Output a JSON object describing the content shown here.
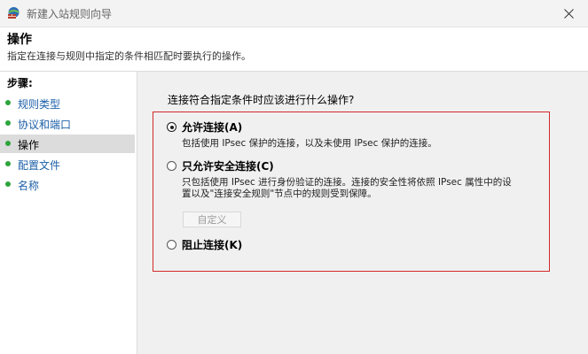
{
  "window": {
    "title": "新建入站规则向导"
  },
  "header": {
    "title": "操作",
    "description": "指定在连接与规则中指定的条件相匹配时要执行的操作。"
  },
  "steps": {
    "heading": "步骤:",
    "items": [
      {
        "label": "规则类型"
      },
      {
        "label": "协议和端口"
      },
      {
        "label": "操作",
        "active": true
      },
      {
        "label": "配置文件"
      },
      {
        "label": "名称"
      }
    ]
  },
  "main": {
    "question": "连接符合指定条件时应该进行什么操作?",
    "options": [
      {
        "label": "允许连接(A)",
        "description": "包括使用 IPsec 保护的连接，以及未使用 IPsec 保护的连接。",
        "checked": true
      },
      {
        "label": "只允许安全连接(C)",
        "description_line1": "只包括使用 IPsec 进行身份验证的连接。连接的安全性将依照 IPsec 属性中的设",
        "description_line2": "置以及\"连接安全规则\"节点中的规则受到保障。",
        "checked": false,
        "button_label": "自定义"
      },
      {
        "label": "阻止连接(K)",
        "checked": false
      }
    ]
  },
  "icons": {
    "app": "firewall-icon",
    "close": "close-icon",
    "step_bullet": "green-dot-icon"
  },
  "colors": {
    "highlight_border": "#d22a2a",
    "step_link": "#1b5fa8",
    "step_bullet": "#2da43c"
  }
}
